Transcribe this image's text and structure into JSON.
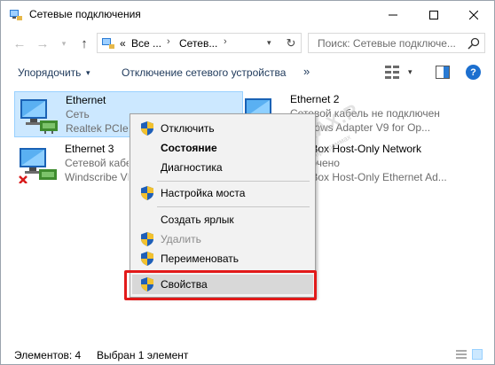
{
  "window": {
    "title": "Сетевые подключения",
    "icon": "network-connections-icon"
  },
  "address": {
    "overflow": "«",
    "crumbs": [
      "Все ...",
      "Сетев..."
    ],
    "separator": "›"
  },
  "search": {
    "placeholder": "Поиск: Сетевые подключе..."
  },
  "commands": {
    "organize": "Упорядочить",
    "disable_device": "Отключение сетевого устройства",
    "more": "»",
    "help": "?"
  },
  "items": [
    {
      "name": "Ethernet",
      "line1": "Сеть",
      "line2": "Realtek PCIe G",
      "selected": true,
      "status": "connected"
    },
    {
      "name": "Ethernet 2",
      "line1": "Сетевой кабель не подключен",
      "line2": "Windows Adapter V9 for Op...",
      "selected": false,
      "status": "disconnected"
    },
    {
      "name": "Ethernet 3",
      "line1": "Сетевой кабе",
      "line2": "Windscribe VP",
      "selected": false,
      "status": "disabled"
    },
    {
      "name": "alBox Host-Only Network",
      "line1": "лючено",
      "line2": "alBox Host-Only Ethernet Ad...",
      "selected": false,
      "status": "connected"
    }
  ],
  "context_menu": {
    "items": [
      {
        "label": "Отключить",
        "shield": true,
        "bold": false,
        "disabled": false
      },
      {
        "label": "Состояние",
        "shield": false,
        "bold": true,
        "disabled": false
      },
      {
        "label": "Диагностика",
        "shield": false,
        "bold": false,
        "disabled": false
      },
      {
        "label": "Настройка моста",
        "shield": true,
        "bold": false,
        "disabled": false
      },
      {
        "label": "Создать ярлык",
        "shield": false,
        "bold": false,
        "disabled": false
      },
      {
        "label": "Удалить",
        "shield": true,
        "bold": false,
        "disabled": true
      },
      {
        "label": "Переименовать",
        "shield": true,
        "bold": false,
        "disabled": false
      },
      {
        "label": "Свойства",
        "shield": true,
        "bold": false,
        "disabled": false,
        "highlighted": true
      }
    ]
  },
  "watermark": {
    "text": "OHOUTBUKAX.R",
    "subtext": "о компьютерах, интернете, программах"
  },
  "status": {
    "count": "Элементов: 4",
    "selected": "Выбран 1 элемент"
  },
  "colors": {
    "selection_bg": "#cce8ff",
    "selection_border": "#99d1ff",
    "highlight_frame": "#e21a1a",
    "menu_bg": "#f2f2f2"
  }
}
